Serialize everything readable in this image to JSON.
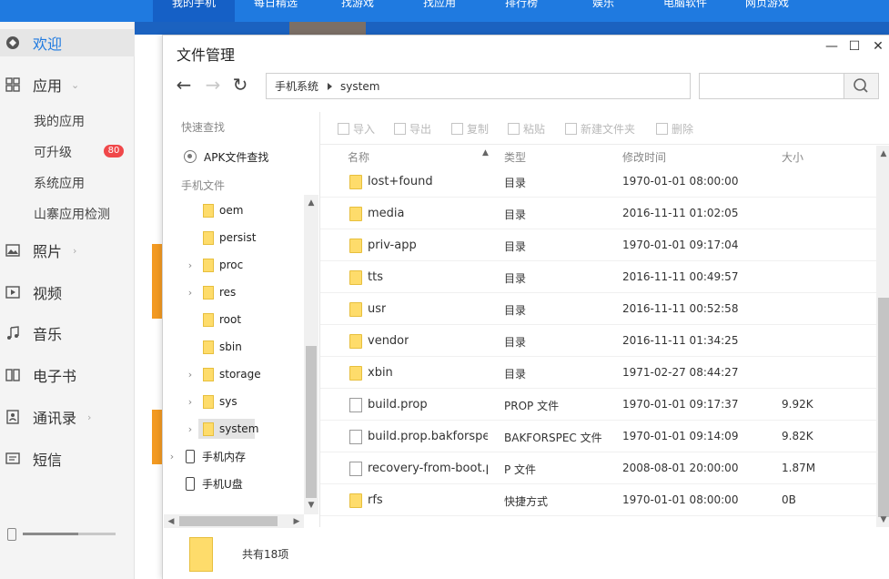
{
  "topnav": {
    "tabs": [
      {
        "label": "我的手机",
        "active": true
      },
      {
        "label": "每日精选",
        "active": false
      },
      {
        "label": "找游戏",
        "active": false
      },
      {
        "label": "找应用",
        "active": false
      },
      {
        "label": "排行榜",
        "active": false
      },
      {
        "label": "娱乐",
        "active": false
      },
      {
        "label": "电脑软件",
        "active": false
      },
      {
        "label": "网页游戏",
        "active": false
      }
    ]
  },
  "sidebar": {
    "welcome": "欢迎",
    "apps": "应用",
    "my_apps": "我的应用",
    "upgradable": "可升级",
    "upgradable_count": "80",
    "system_apps": "系统应用",
    "fake_app_check": "山寨应用检测",
    "photos": "照片",
    "videos": "视频",
    "music": "音乐",
    "ebooks": "电子书",
    "contacts": "通讯录",
    "sms": "短信"
  },
  "dialog": {
    "title": "文件管理",
    "breadcrumb": [
      "手机系统",
      "system"
    ],
    "search_value": "",
    "toolbar": {
      "import": "导入",
      "export": "导出",
      "copy": "复制",
      "paste": "粘贴",
      "new_folder": "新建文件夹",
      "delete": "删除"
    },
    "columns": {
      "name": "名称",
      "type": "类型",
      "modified": "修改时间",
      "size": "大小"
    },
    "tree": {
      "quick_find": "快速查找",
      "apk_find": "APK文件查找",
      "phone_files": "手机文件",
      "folders": [
        {
          "label": "oem",
          "expandable": false
        },
        {
          "label": "persist",
          "expandable": false
        },
        {
          "label": "proc",
          "expandable": true
        },
        {
          "label": "res",
          "expandable": true
        },
        {
          "label": "root",
          "expandable": false
        },
        {
          "label": "sbin",
          "expandable": false
        },
        {
          "label": "storage",
          "expandable": true
        },
        {
          "label": "sys",
          "expandable": true
        },
        {
          "label": "system",
          "expandable": true
        }
      ],
      "internal_storage": "手机内存",
      "usb_disk": "手机U盘"
    },
    "files": [
      {
        "name": "lost+found",
        "type": "目录",
        "modified": "1970-01-01 08:00:00",
        "size": "",
        "kind": "folder"
      },
      {
        "name": "media",
        "type": "目录",
        "modified": "2016-11-11 01:02:05",
        "size": "",
        "kind": "folder"
      },
      {
        "name": "priv-app",
        "type": "目录",
        "modified": "1970-01-01 09:17:04",
        "size": "",
        "kind": "folder"
      },
      {
        "name": "tts",
        "type": "目录",
        "modified": "2016-11-11 00:49:57",
        "size": "",
        "kind": "folder"
      },
      {
        "name": "usr",
        "type": "目录",
        "modified": "2016-11-11 00:52:58",
        "size": "",
        "kind": "folder"
      },
      {
        "name": "vendor",
        "type": "目录",
        "modified": "2016-11-11 01:34:25",
        "size": "",
        "kind": "folder"
      },
      {
        "name": "xbin",
        "type": "目录",
        "modified": "1971-02-27 08:44:27",
        "size": "",
        "kind": "folder"
      },
      {
        "name": "build.prop",
        "type": "PROP 文件",
        "modified": "1970-01-01 09:17:37",
        "size": "9.92K",
        "kind": "file"
      },
      {
        "name": "build.prop.bakforspec",
        "type": "BAKFORSPEC 文件",
        "modified": "1970-01-01 09:14:09",
        "size": "9.82K",
        "kind": "file"
      },
      {
        "name": "recovery-from-boot.p",
        "type": "P 文件",
        "modified": "2008-08-01 20:00:00",
        "size": "1.87M",
        "kind": "file"
      },
      {
        "name": "rfs",
        "type": "快捷方式",
        "modified": "1970-01-01 08:00:00",
        "size": "0B",
        "kind": "folder"
      }
    ],
    "status_count": "共有18项"
  }
}
